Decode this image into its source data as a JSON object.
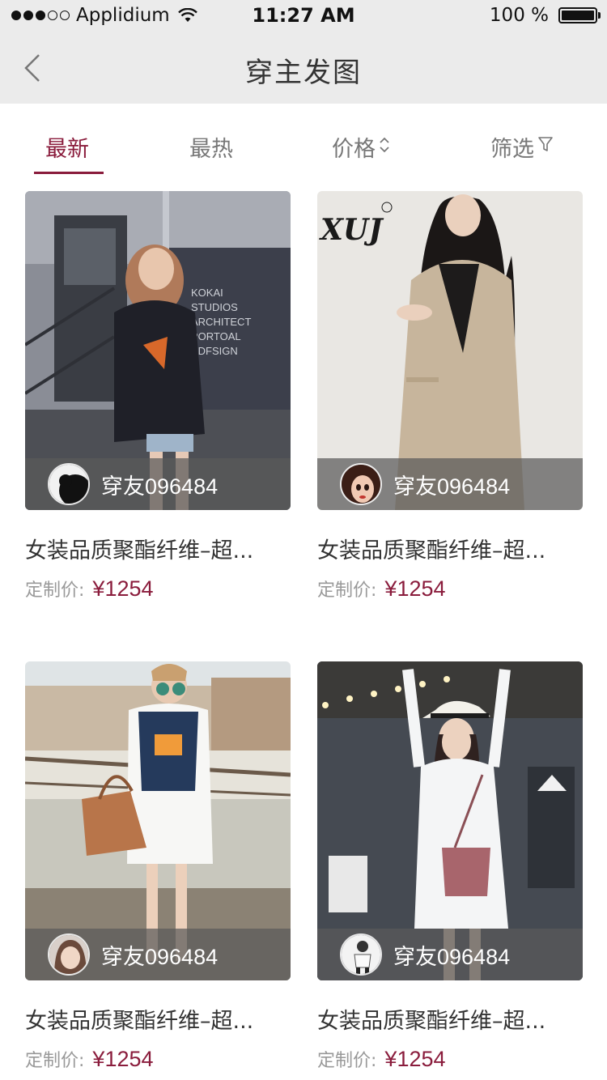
{
  "status_bar": {
    "carrier": "Applidium",
    "time": "11:27 AM",
    "battery": "100 %"
  },
  "nav": {
    "title": "穿主发图",
    "back_icon": "chevron-left-icon"
  },
  "tabs": [
    {
      "label": "最新",
      "active": true
    },
    {
      "label": "最热",
      "active": false
    },
    {
      "label": "价格",
      "active": false,
      "icon": "sort-arrows-icon"
    },
    {
      "label": "筛选",
      "active": false,
      "icon": "filter-icon"
    }
  ],
  "colors": {
    "accent": "#8a1c3c",
    "header_bg": "#ebebeb"
  },
  "products": [
    {
      "user": "穿友096484",
      "title": "女装品质聚酯纤维–超...",
      "price_label": "定制价:",
      "price": "¥1254",
      "photo_mark": ""
    },
    {
      "user": "穿友096484",
      "title": "女装品质聚酯纤维–超...",
      "price_label": "定制价:",
      "price": "¥1254",
      "photo_mark": "XUJ"
    },
    {
      "user": "穿友096484",
      "title": "女装品质聚酯纤维–超...",
      "price_label": "定制价:",
      "price": "¥1254",
      "photo_mark": ""
    },
    {
      "user": "穿友096484",
      "title": "女装品质聚酯纤维–超...",
      "price_label": "定制价:",
      "price": "¥1254",
      "photo_mark": ""
    }
  ]
}
